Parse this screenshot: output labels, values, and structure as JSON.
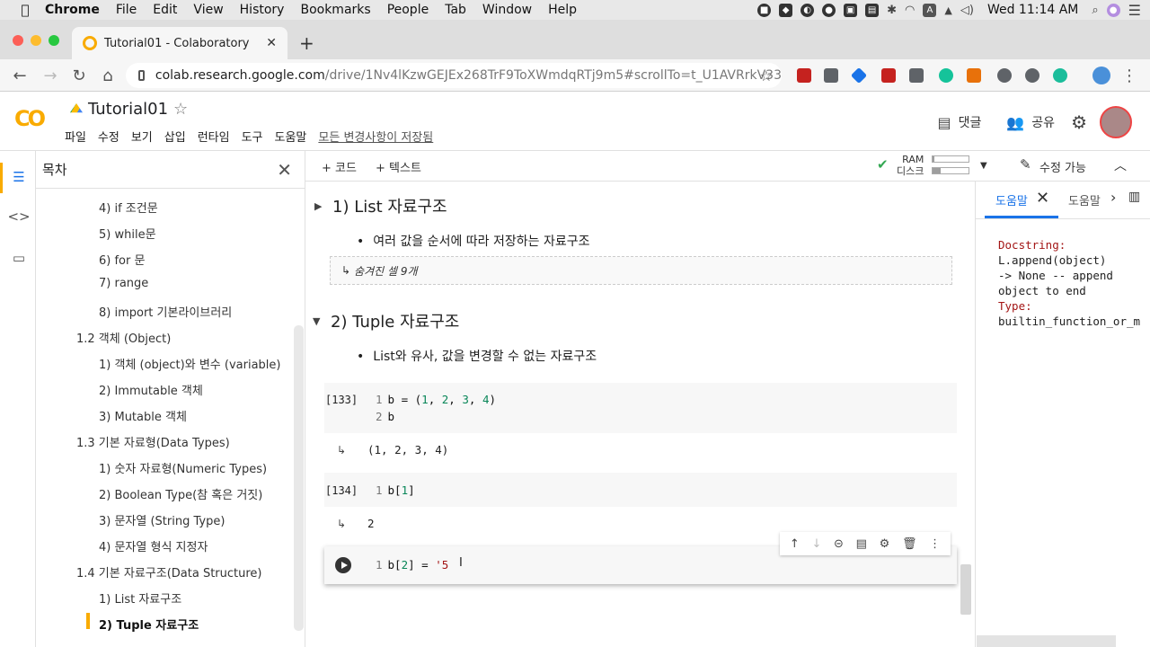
{
  "macos_menubar": {
    "app": "Chrome",
    "items": [
      "File",
      "Edit",
      "View",
      "History",
      "Bookmarks",
      "People",
      "Tab",
      "Window",
      "Help"
    ],
    "clock": "Wed 11:14 AM",
    "input_indicator": "A"
  },
  "browser": {
    "tab_title": "Tutorial01 - Colaboratory",
    "url_domain": "colab.research.google.com",
    "url_path": "/drive/1Nv4lKzwGEJEx268TrF9ToXWmdqRTj9m5#scrollTo=t_U1AVRrkV33"
  },
  "colab": {
    "notebook_title": "Tutorial01",
    "menus": [
      "파일",
      "수정",
      "보기",
      "삽입",
      "런타임",
      "도구",
      "도움말"
    ],
    "saved_status": "모든 변경사항이 저장됨",
    "comment_label": "댓글",
    "share_label": "공유",
    "toolbar": {
      "add_code": "+ 코드",
      "add_text": "+ 텍스트",
      "ram_label": "RAM",
      "disk_label": "디스크",
      "ram_usage": 0.05,
      "disk_usage": 0.22,
      "edit_mode": "수정 가능"
    }
  },
  "toc": {
    "title": "목차",
    "items": [
      "4) if 조건문",
      "5) while문",
      "6) for 문",
      "7) range",
      "8) import 기본라이브러리",
      "1.2 객체 (Object)",
      "1) 객체 (object)와 변수 (variable)",
      "2) Immutable 객체",
      "3) Mutable 객체",
      "1.3 기본 자료형(Data Types)",
      "1) 숫자 자료형(Numeric Types)",
      "2) Boolean Type(참 혹은 거짓)",
      "3) 문자열 (String Type)",
      "4) 문자열 형식 지정자",
      "1.4 기본 자료구조(Data Structure)",
      "1) List 자료구조",
      "2) Tuple 자료구조"
    ]
  },
  "notebook": {
    "section1_title": "1) List 자료구조",
    "section1_bullet": "여러 값을 순서에 따라 저장하는 자료구조",
    "hidden_cells": "숨겨진 셀 9개",
    "hidden_prefix": "↳",
    "section2_title": "2) Tuple 자료구조",
    "section2_bullet": "List와 유사, 값을 변경할 수 없는 자료구조",
    "cell1": {
      "number": "[133]",
      "line1_no": "1",
      "line1_pre": "b = (",
      "n1": "1",
      "n2": "2",
      "n3": "3",
      "n4": "4",
      "line2_no": "2",
      "line2": "b",
      "output": "(1, 2, 3, 4)"
    },
    "cell2": {
      "number": "[134]",
      "line1_no": "1",
      "line1_pre": "b[",
      "idx": "1",
      "line1_post": "]",
      "output": "2"
    },
    "cell3": {
      "line1_no": "1",
      "line1_pre": "b[",
      "idx": "2",
      "line1_mid": "] = ",
      "str": "'5"
    }
  },
  "help_panel": {
    "tab1": "도움말",
    "tab2": "도움말",
    "doc_label": "Docstring:",
    "doc_body": "L.append(object)\n-> None -- append\nobject to end",
    "type_label": "Type:",
    "type_value": "builtin_function_or_m"
  }
}
